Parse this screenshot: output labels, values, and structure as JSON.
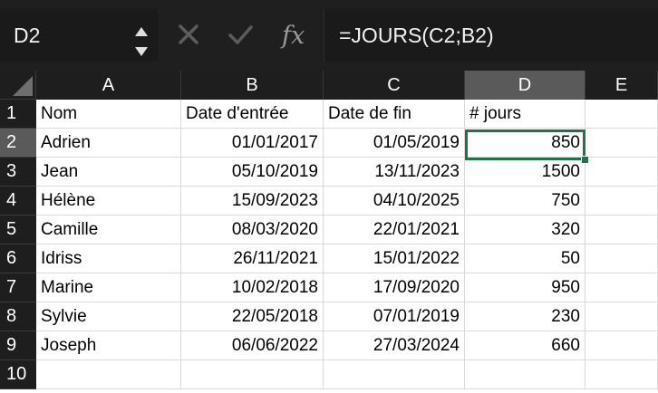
{
  "formula_bar": {
    "name_box": "D2",
    "formula": "=JOURS(C2;B2)",
    "icons": [
      "cancel-icon",
      "confirm-icon",
      "function-icon"
    ]
  },
  "sheet": {
    "columns": [
      "A",
      "B",
      "C",
      "D",
      "E"
    ],
    "rows": [
      "1",
      "2",
      "3",
      "4",
      "5",
      "6",
      "7",
      "8",
      "9",
      "10"
    ],
    "selected_cell": "D2",
    "accent_color": "#217346",
    "header": [
      "Nom",
      "Date d'entrée",
      "Date de fin",
      "# jours"
    ],
    "data": [
      [
        "Adrien",
        "01/01/2017",
        "01/05/2019",
        "850"
      ],
      [
        "Jean",
        "05/10/2019",
        "13/11/2023",
        "1500"
      ],
      [
        "Hélène",
        "15/09/2023",
        "04/10/2025",
        "750"
      ],
      [
        "Camille",
        "08/03/2020",
        "22/01/2021",
        "320"
      ],
      [
        "Idriss",
        "26/11/2021",
        "15/01/2022",
        "50"
      ],
      [
        "Marine",
        "10/02/2018",
        "17/09/2020",
        "950"
      ],
      [
        "Sylvie",
        "22/05/2018",
        "07/01/2019",
        "230"
      ],
      [
        "Joseph",
        "06/06/2022",
        "27/03/2024",
        "660"
      ]
    ]
  }
}
